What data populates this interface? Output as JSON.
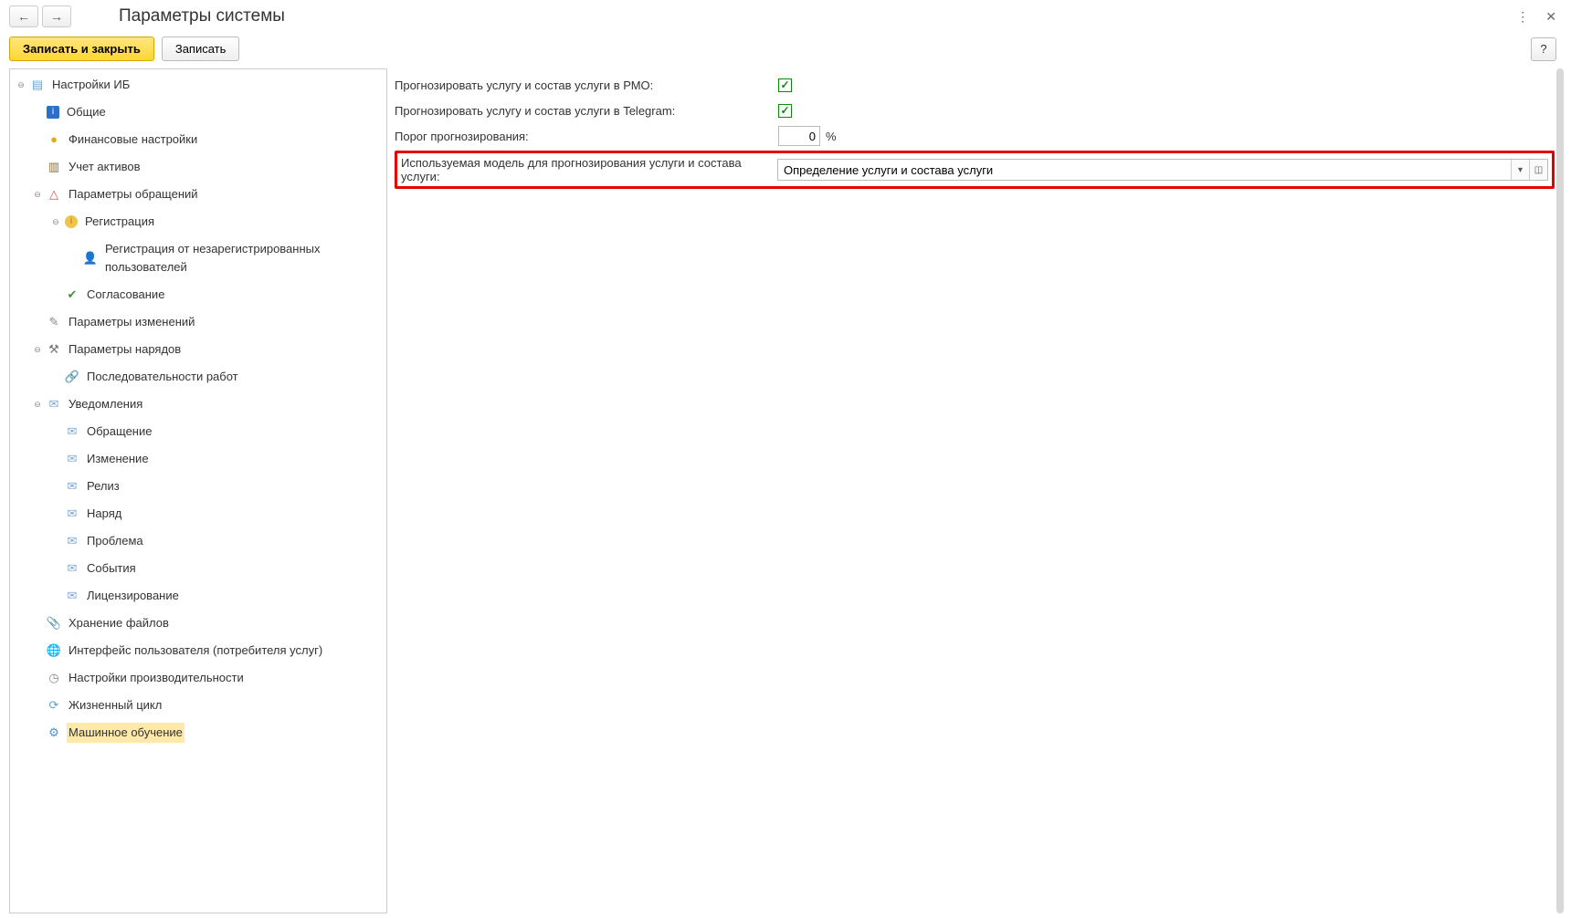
{
  "header": {
    "title": "Параметры системы"
  },
  "toolbar": {
    "save_close": "Записать и закрыть",
    "save": "Записать",
    "help": "?"
  },
  "tree": {
    "root": "Настройки ИБ",
    "general": "Общие",
    "financial": "Финансовые настройки",
    "assets": "Учет активов",
    "requests": "Параметры обращений",
    "registration": "Регистрация",
    "reg_unreg": "Регистрация от незарегистрированных пользователей",
    "approval": "Согласование",
    "changes": "Параметры изменений",
    "orders": "Параметры нарядов",
    "sequences": "Последовательности работ",
    "notifications": "Уведомления",
    "notif_request": "Обращение",
    "notif_change": "Изменение",
    "notif_release": "Релиз",
    "notif_order": "Наряд",
    "notif_problem": "Проблема",
    "notif_events": "События",
    "notif_license": "Лицензирование",
    "files": "Хранение файлов",
    "interface": "Интерфейс пользователя (потребителя услуг)",
    "performance": "Настройки производительности",
    "lifecycle": "Жизненный цикл",
    "ml": "Машинное обучение"
  },
  "form": {
    "predict_rmo_label": "Прогнозировать услугу и состав услуги в РМО:",
    "predict_telegram_label": "Прогнозировать услугу и состав услуги в Telegram:",
    "threshold_label": "Порог прогнозирования:",
    "threshold_value": "0",
    "threshold_unit": "%",
    "model_label": "Используемая модель для прогнозирования услуги и состава услуги:",
    "model_value": "Определение услуги и состава услуги"
  }
}
